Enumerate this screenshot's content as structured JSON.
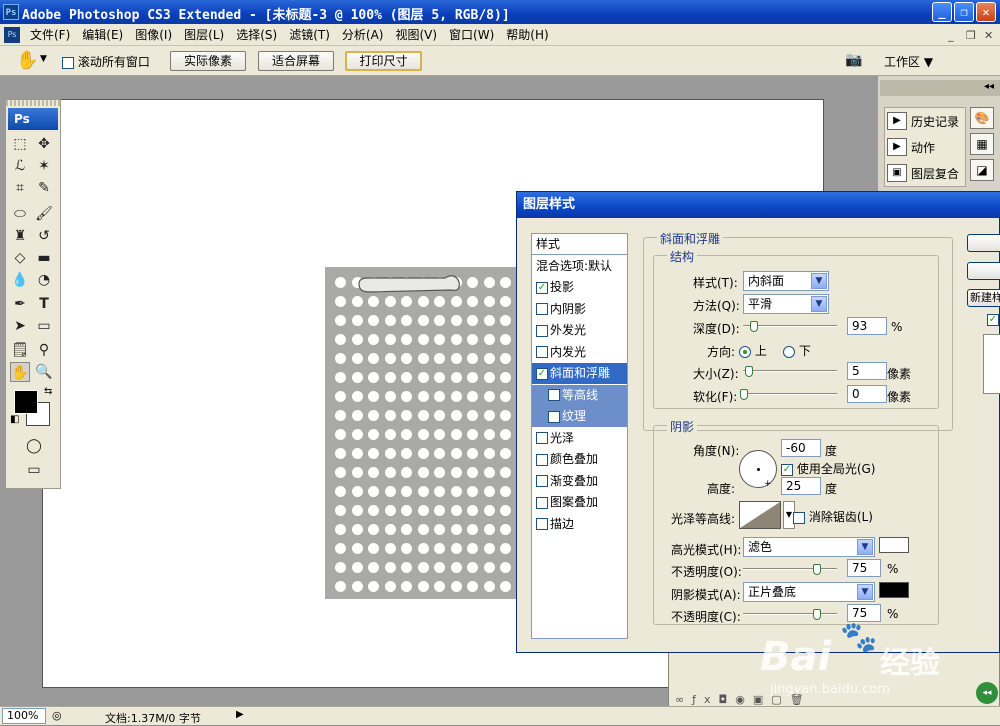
{
  "window": {
    "app_logo": "Ps",
    "title": "Adobe Photoshop CS3 Extended - [未标题-3 @ 100% (图层 5, RGB/8)]",
    "btn_min": "_",
    "btn_max": "❐",
    "btn_close": "✕"
  },
  "menubar": {
    "doc_logo": "Ps",
    "items": [
      "文件(F)",
      "编辑(E)",
      "图像(I)",
      "图层(L)",
      "选择(S)",
      "滤镜(T)",
      "分析(A)",
      "视图(V)",
      "窗口(W)",
      "帮助(H)"
    ],
    "mdi_min": "_",
    "mdi_restore": "❐",
    "mdi_close": "✕"
  },
  "options": {
    "scroll_all_windows": "滚动所有窗口",
    "actual_pixels": "实际像素",
    "fit_screen": "适合屏幕",
    "print_size": "打印尺寸",
    "workspace": "工作区 ▼"
  },
  "tools": {
    "logo": "Ps"
  },
  "panels": {
    "collapse": "◂◂",
    "items": [
      "历史记录",
      "动作",
      "图层复合"
    ]
  },
  "statusbar": {
    "zoom": "100%",
    "doc_info": "文档:1.37M/0 字节"
  },
  "dialog": {
    "title": "图层样式",
    "style_list": {
      "header": "样式",
      "blend": "混合选项:默认",
      "items": [
        {
          "label": "投影",
          "checked": true
        },
        {
          "label": "内阴影",
          "checked": false
        },
        {
          "label": "外发光",
          "checked": false
        },
        {
          "label": "内发光",
          "checked": false
        },
        {
          "label": "斜面和浮雕",
          "checked": true
        },
        {
          "label": "等高线",
          "checked": false
        },
        {
          "label": "纹理",
          "checked": false
        },
        {
          "label": "光泽",
          "checked": false
        },
        {
          "label": "颜色叠加",
          "checked": false
        },
        {
          "label": "渐变叠加",
          "checked": false
        },
        {
          "label": "图案叠加",
          "checked": false
        },
        {
          "label": "描边",
          "checked": false
        }
      ]
    },
    "bevel": {
      "title": "斜面和浮雕",
      "structure": "结构",
      "style_label": "样式(T):",
      "style_value": "内斜面",
      "technique_label": "方法(Q):",
      "technique_value": "平滑",
      "depth_label": "深度(D):",
      "depth_value": "93",
      "depth_unit": "%",
      "direction_label": "方向:",
      "dir_up": "上",
      "dir_down": "下",
      "size_label": "大小(Z):",
      "size_value": "5",
      "size_unit": "像素",
      "soften_label": "软化(F):",
      "soften_value": "0",
      "soften_unit": "像素"
    },
    "shading": {
      "title": "阴影",
      "angle_label": "角度(N):",
      "angle_value": "-60",
      "angle_unit": "度",
      "global_light": "使用全局光(G)",
      "altitude_label": "高度:",
      "altitude_value": "25",
      "altitude_unit": "度",
      "gloss_label": "光泽等高线:",
      "antialias": "消除锯齿(L)",
      "highlight_mode_label": "高光模式(H):",
      "highlight_mode": "滤色",
      "highlight_color": "#ffffff",
      "opacity_label": "不透明度(O):",
      "highlight_opacity": "75",
      "opacity_unit": "%",
      "shadow_mode_label": "阴影模式(A):",
      "shadow_mode": "正片叠底",
      "shadow_color": "#000000",
      "opacity2_label": "不透明度(C):",
      "shadow_opacity": "75",
      "opacity2_unit": "%"
    },
    "buttons": {
      "new_style": "新建样"
    }
  },
  "watermark": {
    "brand": "Bai",
    "brand2": "经验",
    "url": "jingyan.baidu.com"
  }
}
